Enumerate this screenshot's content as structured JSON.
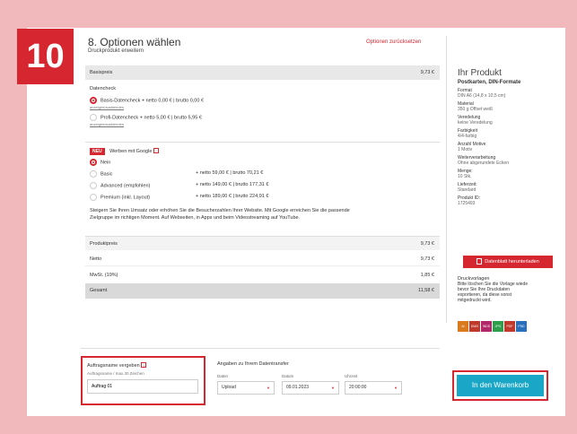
{
  "step_number": "10",
  "header": {
    "title": "8. Optionen wählen",
    "subtitle": "Druckprodukt erweitern",
    "reset_link": "Optionen zurücksetzen"
  },
  "basispreis": {
    "label": "Basispreis",
    "value": "9,73 €"
  },
  "datencheck": {
    "heading": "Datencheck",
    "options": [
      {
        "label": "Basis-Datencheck + netto 0,00 € | brutto 0,00 €",
        "link": "anzeigen/ausblenden",
        "selected": true
      },
      {
        "label": "Profi-Datencheck + netto 5,00 € | brutto 5,95 €",
        "link": "anzeigen/ausblenden",
        "selected": false
      }
    ]
  },
  "google": {
    "badge": "NEU",
    "heading": "Werben mit Google",
    "info": "i",
    "options": [
      {
        "label": "Nein",
        "price": "",
        "selected": true
      },
      {
        "label": "Basic",
        "price": "+ netto 59,00 € | brutto 70,21 €",
        "selected": false
      },
      {
        "label": "Advanced (empfohlen)",
        "price": "+ netto 149,00 € | brutto 177,31 €",
        "selected": false
      },
      {
        "label": "Premium (inkl. Layout)",
        "price": "+ netto 189,00 € | brutto 224,91 €",
        "selected": false
      }
    ],
    "description_line1": "Steigern Sie Ihren Umsatz oder erhöhen Sie die Besucherzahlen Ihrer Website. Mit Google erreichen Sie die passende",
    "description_line2": "Zielgruppe im richtigen Moment. Auf Webseiten, in Apps und beim Videostreaming auf YouTube."
  },
  "totals": [
    {
      "label": "Produktpreis",
      "value": "9,73 €",
      "style": "light"
    },
    {
      "label": "Netto",
      "value": "9,73 €",
      "style": "white"
    },
    {
      "label": "MwSt. (19%)",
      "value": "1,85 €",
      "style": "white"
    },
    {
      "label": "Gesamt",
      "value": "11,58 €",
      "style": "grey"
    }
  ],
  "product": {
    "heading": "Ihr Produkt",
    "name": "Postkarten, DIN-Formate",
    "specs": [
      {
        "label": "Format",
        "value": "DIN A6 (14,8 x 10,5 cm)"
      },
      {
        "label": "Material",
        "value": "350 g Offset weiß"
      },
      {
        "label": "Veredelung",
        "value": "keine Veredelung"
      },
      {
        "label": "Farbigkeit",
        "value": "4/4-farbig"
      },
      {
        "label": "Anzahl Motive",
        "value": "1 Motiv"
      },
      {
        "label": "Weiterverarbeitung",
        "value": "Ohne abgerundete Ecken"
      },
      {
        "label": "Menge:",
        "value": "10 Stk."
      },
      {
        "label": "Lieferzeit:",
        "value": "Standard"
      },
      {
        "label": "Produkt ID:",
        "value": "1725493"
      }
    ],
    "datasheet_button": "Datenblatt herunterladen",
    "templates_heading": "Druckvorlagen",
    "templates_text": [
      "Bitte löschen Sie die Vorlage wiede",
      "bevor Sie Ihre Druckdaten",
      "exportieren, da diese sonst",
      "mitgedruckt wird."
    ],
    "formats": [
      {
        "label": "AI",
        "color": "#d97a1c"
      },
      {
        "label": "DWG",
        "color": "#c0392b"
      },
      {
        "label": "INDD",
        "color": "#b0286a"
      },
      {
        "label": "JPG",
        "color": "#2e9e4a"
      },
      {
        "label": "PDF",
        "color": "#c0392b"
      },
      {
        "label": "PSD",
        "color": "#2a6fbe"
      }
    ]
  },
  "order": {
    "heading": "Auftragsname vergeben",
    "info": "i",
    "field_label": "Auftragsname / max.30 Zeichen",
    "field_value": "Auftrag 01"
  },
  "transfer": {
    "heading": "Angaben zu Ihrem Datentransfer",
    "fields": [
      {
        "label": "Daten",
        "value": "Upload"
      },
      {
        "label": "Datum",
        "value": "09.01.2023"
      },
      {
        "label": "Uhrzeit",
        "value": "20:00:00"
      }
    ]
  },
  "cart_button": "In den Warenkorb"
}
